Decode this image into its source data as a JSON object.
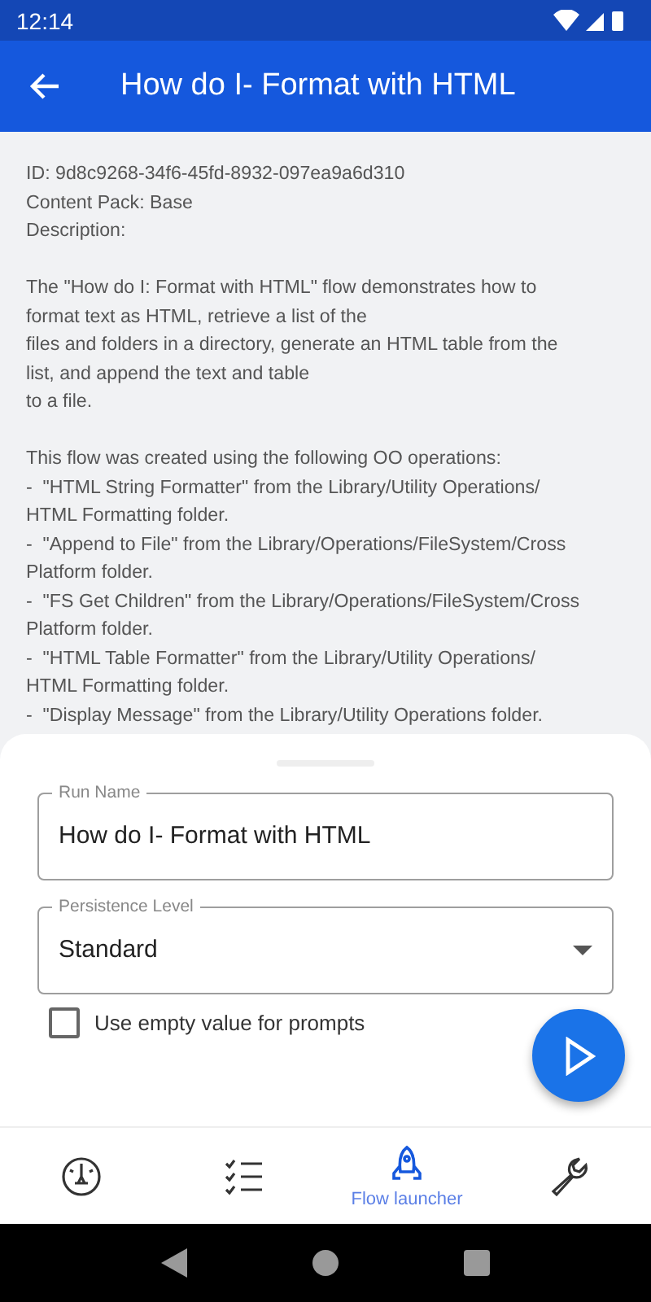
{
  "status_bar": {
    "time": "12:14"
  },
  "app_bar": {
    "title": "How do I- Format with HTML"
  },
  "details": {
    "id": "ID: 9d8c9268-34f6-45fd-8932-097ea9a6d310",
    "content_pack": "Content Pack: Base",
    "description_label": "Description:",
    "paragraphs": [
      "The \"How do I: Format with HTML\" flow demonstrates how to\nformat text as HTML, retrieve a list of the\nfiles and folders in a directory, generate an HTML table from the\nlist, and append the text and table\nto a file.",
      "This flow was created using the following OO operations:\n-  \"HTML String Formatter\" from the Library/Utility Operations/\nHTML Formatting folder.\n-  \"Append to File\" from the Library/Operations/FileSystem/Cross\nPlatform folder.\n-  \"FS Get Children\" from the Library/Operations/FileSystem/Cross\nPlatform folder.\n-  \"HTML Table Formatter\" from the Library/Utility Operations/\nHTML Formatting folder.\n-  \"Display Message\" from the Library/Utility Operations folder."
    ]
  },
  "run_form": {
    "run_name": {
      "label": "Run Name",
      "value": "How do I- Format with HTML"
    },
    "persistence": {
      "label": "Persistence Level",
      "value": "Standard"
    },
    "empty_prompts": {
      "label": "Use empty value for prompts",
      "checked": false
    }
  },
  "bottom_nav": [
    {
      "kind": "dashboard",
      "selected": false
    },
    {
      "kind": "checklist",
      "selected": false
    },
    {
      "kind": "rocket",
      "selected": true,
      "label": "Flow launcher"
    },
    {
      "kind": "wrench",
      "selected": false
    }
  ]
}
